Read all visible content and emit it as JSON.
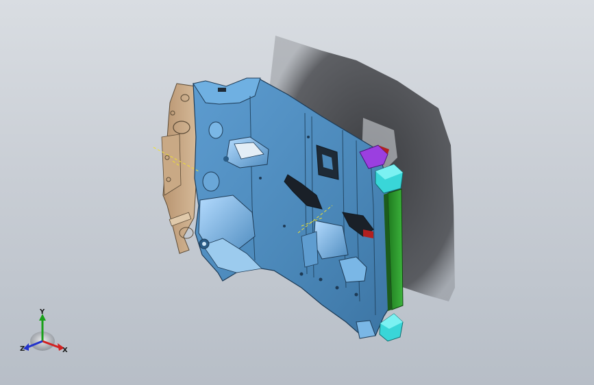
{
  "viewport": {
    "background_top": "#d9dde2",
    "background_bottom": "#b7bec7"
  },
  "model": {
    "panel_color": "#4a87b8",
    "panel_highlight": "#8cc3ec",
    "bracket_color": "#c7a987",
    "shadow_color": "#2b2c2f",
    "accent_purple": "#9b3fe0",
    "accent_cyan": "#39d6d8",
    "accent_green": "#2f9c2f",
    "accent_red": "#b12020"
  },
  "triad": {
    "x_label": "X",
    "y_label": "Y",
    "z_label": "Z",
    "x_color": "#d32020",
    "y_color": "#1aa01a",
    "z_color": "#2233cc",
    "icons": [
      "x-axis-arrow-icon",
      "y-axis-arrow-icon",
      "z-axis-arrow-icon"
    ]
  }
}
